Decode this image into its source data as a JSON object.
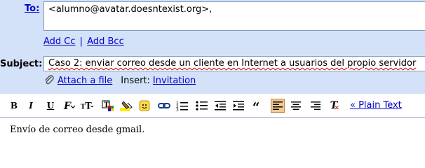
{
  "compose": {
    "to_label": "To:",
    "to_value": "<alumno@avatar.doesntexist.org>,",
    "add_cc": "Add Cc",
    "separator": "|",
    "add_bcc": "Add Bcc",
    "subject_label": "Subject:",
    "subject_value": "Caso 2: enviar correo desde un cliente en Internet a usuarios del propio servidor",
    "attach_label": "Attach a file",
    "insert_label": "Insert:",
    "invitation_label": "Invitation",
    "plain_text_label": "« Plain Text",
    "body_text": "Envío de correo desde gmail."
  },
  "toolbar": {
    "bold": "B",
    "italic": "I",
    "underline": "U",
    "font": "F",
    "size": "T",
    "remove_format": "T"
  },
  "colors": {
    "panel_bg": "#d3e1f9",
    "link": "#0000cc",
    "active_button": "#f0c890"
  }
}
